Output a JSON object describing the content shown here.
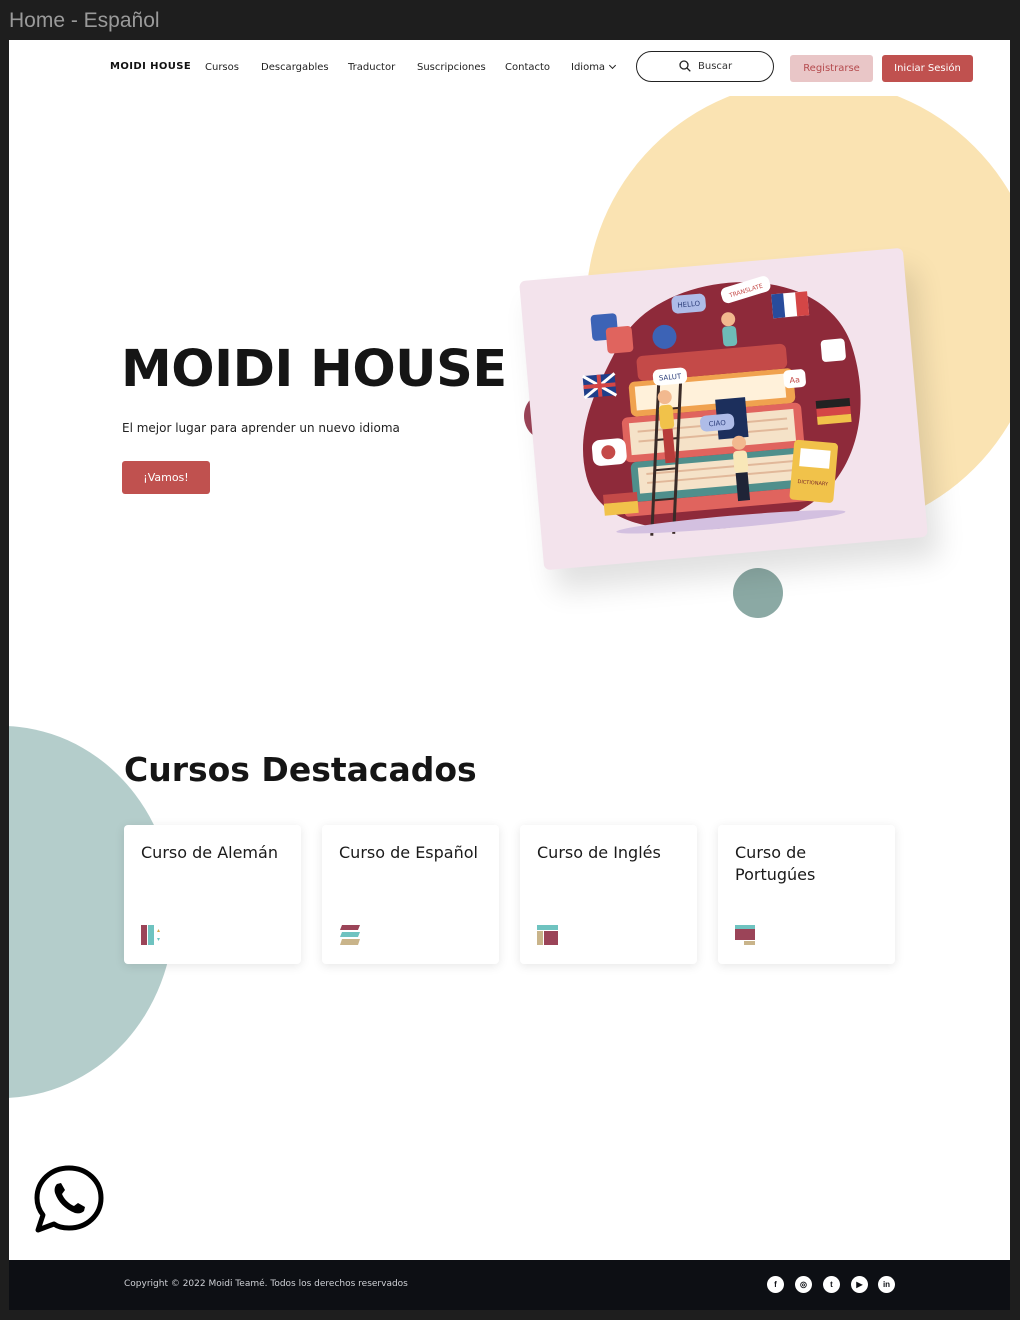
{
  "window": {
    "title": "Home - Español"
  },
  "nav": {
    "brand": "MOIDI HOUSE",
    "links": [
      "Cursos",
      "Descargables",
      "Traductor",
      "Suscripciones",
      "Contacto"
    ],
    "language_label": "Idioma",
    "search_placeholder": "Buscar",
    "register_label": "Registrarse",
    "login_label": "Iniciar Sesión"
  },
  "hero": {
    "title": "MOIDI HOUSE",
    "subtitle": "El mejor lugar para aprender un nuevo idioma",
    "cta_label": "¡Vamos!",
    "illustration_words": [
      "HELLO",
      "TRANSLATE",
      "SALUT",
      "CIAO",
      "Aa",
      "DICTIONARY"
    ]
  },
  "courses": {
    "title": "Cursos Destacados",
    "items": [
      {
        "label": "Curso de Alemán",
        "icon": "book-columns-icon"
      },
      {
        "label": "Curso de Español",
        "icon": "stack-layers-icon"
      },
      {
        "label": "Curso de Inglés",
        "icon": "layout-icon"
      },
      {
        "label": "Curso de Portugúes",
        "icon": "monitor-icon"
      }
    ]
  },
  "footer": {
    "copyright": "Copyright © 2022 Moidi Teamé. Todos los derechos reservados",
    "social": [
      {
        "name": "facebook-icon",
        "glyph": "f"
      },
      {
        "name": "instagram-icon",
        "glyph": "◎"
      },
      {
        "name": "twitter-icon",
        "glyph": "t"
      },
      {
        "name": "youtube-icon",
        "glyph": "▶"
      },
      {
        "name": "linkedin-icon",
        "glyph": "in"
      }
    ]
  },
  "colors": {
    "accent": "#c0514f",
    "accent_light": "#e9c6c7",
    "yellow": "#fae3b2",
    "teal": "#b4cdcb",
    "footer_bg": "#0d0f14"
  }
}
